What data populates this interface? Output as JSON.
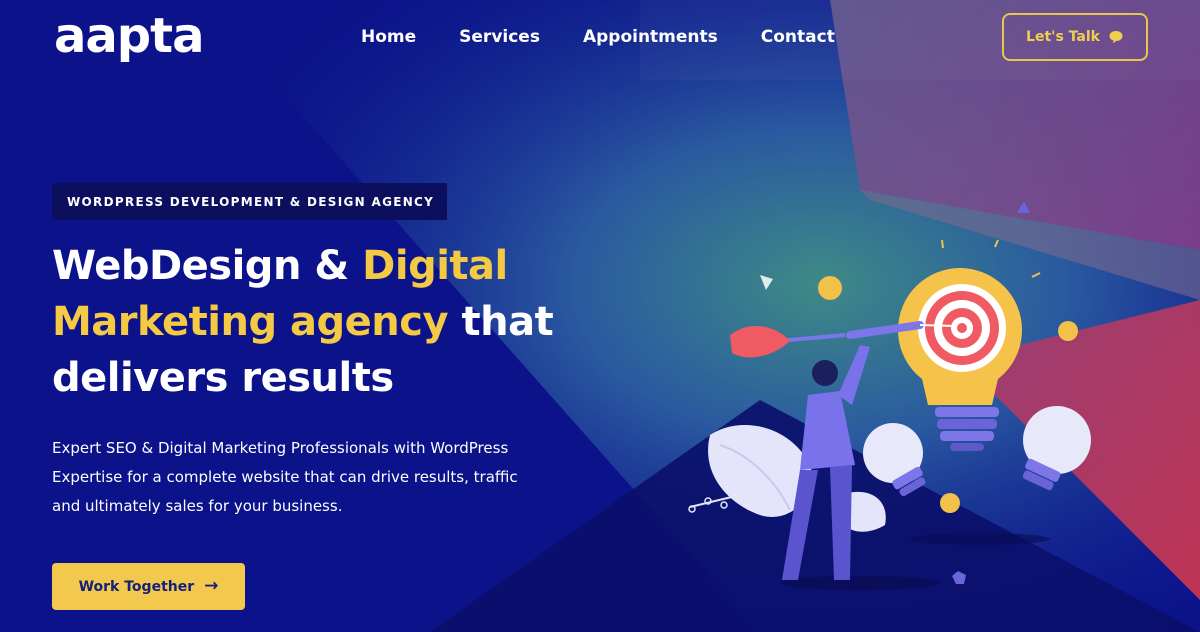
{
  "brand": {
    "logo_text": "aapta",
    "accent_color": "#f2c94c",
    "background_color": "#0b128a"
  },
  "nav": {
    "items": [
      {
        "label": "Home"
      },
      {
        "label": "Services"
      },
      {
        "label": "Appointments"
      },
      {
        "label": "Contact"
      }
    ]
  },
  "header": {
    "cta_label": "Let's Talk",
    "cta_icon": "chat-bubble-icon"
  },
  "hero": {
    "eyebrow": "WORDPRESS DEVELOPMENT & DESIGN AGENCY",
    "title_part1": "WebDesign & ",
    "title_accent": "Digital Marketing agency",
    "title_part2": " that delivers results",
    "description": "Expert SEO & Digital Marketing Professionals with WordPress Expertise for a complete website that can drive results, traffic and ultimately sales for your business.",
    "button_label": "Work Together",
    "button_icon": "arrow-right-icon"
  },
  "illustration": {
    "subject": "person-throwing-dart-at-lightbulb-target"
  }
}
